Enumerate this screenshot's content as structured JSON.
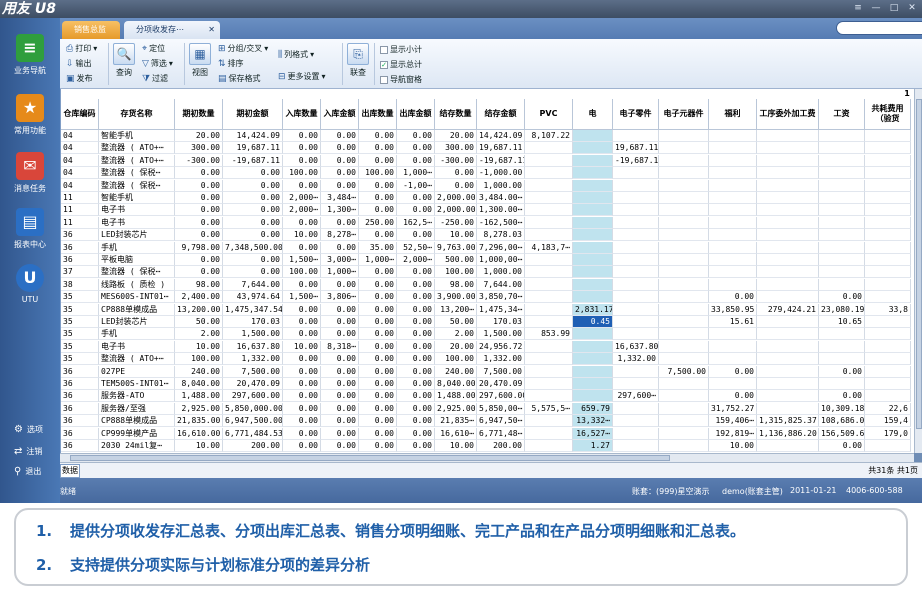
{
  "window": {
    "logo": "用友 U8",
    "buttons": [
      "≡",
      "—",
      "□",
      "✕"
    ]
  },
  "nav": {
    "items": [
      {
        "label": "业务导航",
        "icon": "business-nav-icon",
        "glyph": "≡",
        "color": "#2f9e3d"
      },
      {
        "label": "常用功能",
        "icon": "star-icon",
        "glyph": "★",
        "color": "#e68a1a"
      },
      {
        "label": "消息任务",
        "icon": "message-icon",
        "glyph": "✉",
        "color": "#d9463a"
      },
      {
        "label": "报表中心",
        "icon": "report-icon",
        "glyph": "▤",
        "color": "#2b6fc4"
      },
      {
        "label": "UTU",
        "icon": "utu-icon",
        "glyph": "U",
        "color": "#2b6fc4"
      }
    ],
    "bottom": [
      {
        "label": "选项",
        "icon": "gear-icon",
        "glyph": "⚙"
      },
      {
        "label": "注销",
        "icon": "logout-icon",
        "glyph": "⇄"
      },
      {
        "label": "退出",
        "icon": "exit-icon",
        "glyph": "⚲"
      }
    ]
  },
  "tabs": [
    {
      "label": "销售总监"
    },
    {
      "label": "分项收发存⋯"
    }
  ],
  "search": {
    "placeholder": ""
  },
  "toolbar": {
    "print": "打印",
    "export": "输出",
    "publish": "发布",
    "query": "查询",
    "locate": "定位",
    "filter": "筛选",
    "filter2": "过滤",
    "view": "视图",
    "group": "分组/交叉",
    "sort": "排序",
    "save_format": "保存格式",
    "col_format": "列格式",
    "more_settings": "更多设置",
    "drill": "联查",
    "show_subtotal": "显示小计",
    "show_total": "显示总计",
    "nav_pane": "导航窗格"
  },
  "grid": {
    "headers": [
      "仓库编码",
      "存货名称",
      "期初数量",
      "期初金额",
      "入库数量",
      "入库金额",
      "出库数量",
      "出库金额",
      "结存数量",
      "结存金额",
      "PVC",
      "电",
      "电子零件",
      "电子元器件",
      "福利",
      "工序委外加工费",
      "工资",
      "共耗费用（验货"
    ],
    "page_marker": "1",
    "rows": [
      [
        "04",
        "智能手机",
        "20.00",
        "14,424.09",
        "0.00",
        "0.00",
        "0.00",
        "0.00",
        "20.00",
        "14,424.09",
        "8,107.22",
        "",
        "",
        "",
        "",
        "",
        "",
        ""
      ],
      [
        "04",
        "整流器 ( ATO+⋯",
        "300.00",
        "19,687.11",
        "0.00",
        "0.00",
        "0.00",
        "0.00",
        "300.00",
        "19,687.11",
        "",
        "",
        "19,687.11",
        "",
        "",
        "",
        "",
        ""
      ],
      [
        "04",
        "整流器 ( ATO+⋯",
        "-300.00",
        "-19,687.11",
        "0.00",
        "0.00",
        "0.00",
        "0.00",
        "-300.00",
        "-19,687.11",
        "",
        "",
        "-19,687.11",
        "",
        "",
        "",
        "",
        ""
      ],
      [
        "04",
        "整流器 ( 保税⋯",
        "0.00",
        "0.00",
        "100.00",
        "0.00",
        "100.00",
        "1,000⋯",
        "0.00",
        "-1,000.00",
        "",
        "",
        "",
        "",
        "",
        "",
        "",
        ""
      ],
      [
        "04",
        "整流器 ( 保税⋯",
        "0.00",
        "0.00",
        "0.00",
        "0.00",
        "0.00",
        "-1,00⋯",
        "0.00",
        "1,000.00",
        "",
        "",
        "",
        "",
        "",
        "",
        "",
        ""
      ],
      [
        "11",
        "智能手机",
        "0.00",
        "0.00",
        "2,000⋯",
        "3,484⋯",
        "0.00",
        "0.00",
        "2,000.00",
        "3,484.00⋯",
        "",
        "",
        "",
        "",
        "",
        "",
        "",
        ""
      ],
      [
        "11",
        "电子书",
        "0.00",
        "0.00",
        "2,000⋯",
        "1,300⋯",
        "0.00",
        "0.00",
        "2,000.00",
        "1,300.00⋯",
        "",
        "",
        "",
        "",
        "",
        "",
        "",
        ""
      ],
      [
        "11",
        "电子书",
        "0.00",
        "0.00",
        "0.00",
        "0.00",
        "250.00",
        "162,5⋯",
        "-250.00",
        "-162,500⋯",
        "",
        "",
        "",
        "",
        "",
        "",
        "",
        ""
      ],
      [
        "36",
        "LED封装芯片",
        "0.00",
        "0.00",
        "10.00",
        "8,278⋯",
        "0.00",
        "0.00",
        "10.00",
        "8,278.03",
        "",
        "",
        "",
        "",
        "",
        "",
        "",
        ""
      ],
      [
        "36",
        "手机",
        "9,798.00",
        "7,348,500.00",
        "0.00",
        "0.00",
        "35.00",
        "52,50⋯",
        "9,763.00",
        "7,296,00⋯",
        "4,183,7⋯",
        "",
        "",
        "",
        "",
        "",
        "",
        ""
      ],
      [
        "36",
        "平板电脑",
        "0.00",
        "0.00",
        "1,500⋯",
        "3,000⋯",
        "1,000⋯",
        "2,000⋯",
        "500.00",
        "1,000,00⋯",
        "",
        "",
        "",
        "",
        "",
        "",
        "",
        ""
      ],
      [
        "37",
        "整流器 ( 保税⋯",
        "0.00",
        "0.00",
        "100.00",
        "1,000⋯",
        "0.00",
        "0.00",
        "100.00",
        "1,000.00",
        "",
        "",
        "",
        "",
        "",
        "",
        "",
        ""
      ],
      [
        "38",
        "线路板 ( 质检 )",
        "98.00",
        "7,644.00",
        "0.00",
        "0.00",
        "0.00",
        "0.00",
        "98.00",
        "7,644.00",
        "",
        "",
        "",
        "",
        "",
        "",
        "",
        ""
      ],
      [
        "35",
        "MES600S-INT01⋯",
        "2,400.00",
        "43,974.64",
        "1,500⋯",
        "3,806⋯",
        "0.00",
        "0.00",
        "3,900.00",
        "3,850,70⋯",
        "",
        "",
        "",
        "",
        "0.00",
        "",
        "0.00",
        ""
      ],
      [
        "35",
        "CP888单模成品",
        "13,200.00",
        "1,475,347.54",
        "0.00",
        "0.00",
        "0.00",
        "0.00",
        "13,200⋯",
        "1,475,34⋯",
        "",
        "2,831.17",
        "",
        "",
        "33,850.95",
        "279,424.21",
        "23,080.19",
        "33,8"
      ],
      [
        "35",
        "LED封装芯片",
        "50.00",
        "170.03",
        "0.00",
        "0.00",
        "0.00",
        "0.00",
        "50.00",
        "170.03",
        "",
        "0.45",
        "",
        "",
        "15.61",
        "",
        "10.65",
        ""
      ],
      [
        "35",
        "手机",
        "2.00",
        "1,500.00",
        "0.00",
        "0.00",
        "0.00",
        "0.00",
        "2.00",
        "1,500.00",
        "853.99",
        "",
        "",
        "",
        "",
        "",
        "",
        ""
      ],
      [
        "35",
        "电子书",
        "10.00",
        "16,637.80",
        "10.00",
        "8,318⋯",
        "0.00",
        "0.00",
        "20.00",
        "24,956.72",
        "",
        "",
        "16,637.80",
        "",
        "",
        "",
        "",
        ""
      ],
      [
        "35",
        "整流器 ( ATO+⋯",
        "100.00",
        "1,332.00",
        "0.00",
        "0.00",
        "0.00",
        "0.00",
        "100.00",
        "1,332.00",
        "",
        "",
        "1,332.00",
        "",
        "",
        "",
        "",
        ""
      ],
      [
        "36",
        "027PE",
        "240.00",
        "7,500.00",
        "0.00",
        "0.00",
        "0.00",
        "0.00",
        "240.00",
        "7,500.00",
        "",
        "",
        "",
        "7,500.00",
        "0.00",
        "",
        "0.00",
        ""
      ],
      [
        "36",
        "TEM500S-INT01⋯",
        "8,040.00",
        "20,470.09",
        "0.00",
        "0.00",
        "0.00",
        "0.00",
        "8,040.00",
        "20,470.09",
        "",
        "",
        "",
        "",
        "",
        "",
        "",
        ""
      ],
      [
        "36",
        "服务器-ATO",
        "1,488.00",
        "297,600.00",
        "0.00",
        "0.00",
        "0.00",
        "0.00",
        "1,488.00",
        "297,600.00",
        "",
        "",
        "297,600⋯",
        "",
        "0.00",
        "",
        "0.00",
        ""
      ],
      [
        "36",
        "服务器/至强",
        "2,925.00",
        "5,850,000.00",
        "0.00",
        "0.00",
        "0.00",
        "0.00",
        "2,925.00",
        "5,850,00⋯",
        "5,575,5⋯",
        "659.79",
        "",
        "",
        "31,752.27",
        "",
        "10,309.18",
        "22,6"
      ],
      [
        "36",
        "CP888单模成品",
        "21,835.00",
        "6,947,500.00",
        "0.00",
        "0.00",
        "0.00",
        "0.00",
        "21,835⋯",
        "6,947,50⋯",
        "",
        "13,332⋯",
        "",
        "",
        "159,406⋯",
        "1,315,825.37",
        "108,686.02",
        "159,4"
      ],
      [
        "36",
        "CP999单模产品",
        "16,610.00",
        "6,771,484.53",
        "0.00",
        "0.00",
        "0.00",
        "0.00",
        "16,610⋯",
        "6,771,48⋯",
        "",
        "16,527⋯",
        "",
        "",
        "192,819⋯",
        "1,136,886.20",
        "156,509.66",
        "179,0"
      ],
      [
        "36",
        "2030 24mil复⋯",
        "10.00",
        "200.00",
        "0.00",
        "0.00",
        "0.00",
        "0.00",
        "10.00",
        "200.00",
        "",
        "1.27",
        "",
        "",
        "10.00",
        "",
        "0.00",
        ""
      ]
    ]
  },
  "status": {
    "data_tab": "数据",
    "records": "共31条 共1页"
  },
  "bottombar": {
    "ready": "就绪",
    "account": "账套：(999)星空演示",
    "user": "demo(账套主管)",
    "date": "2011-01-21",
    "phone": "4006-600-588"
  },
  "caption": {
    "items": [
      {
        "num": "1.",
        "text": "提供分项收发存汇总表、分项出库汇总表、销售分项明细账、完工产品和在产品分项明细账和汇总表。"
      },
      {
        "num": "2.",
        "text": "支持提供分项实际与计划标准分项的差异分析"
      }
    ]
  }
}
